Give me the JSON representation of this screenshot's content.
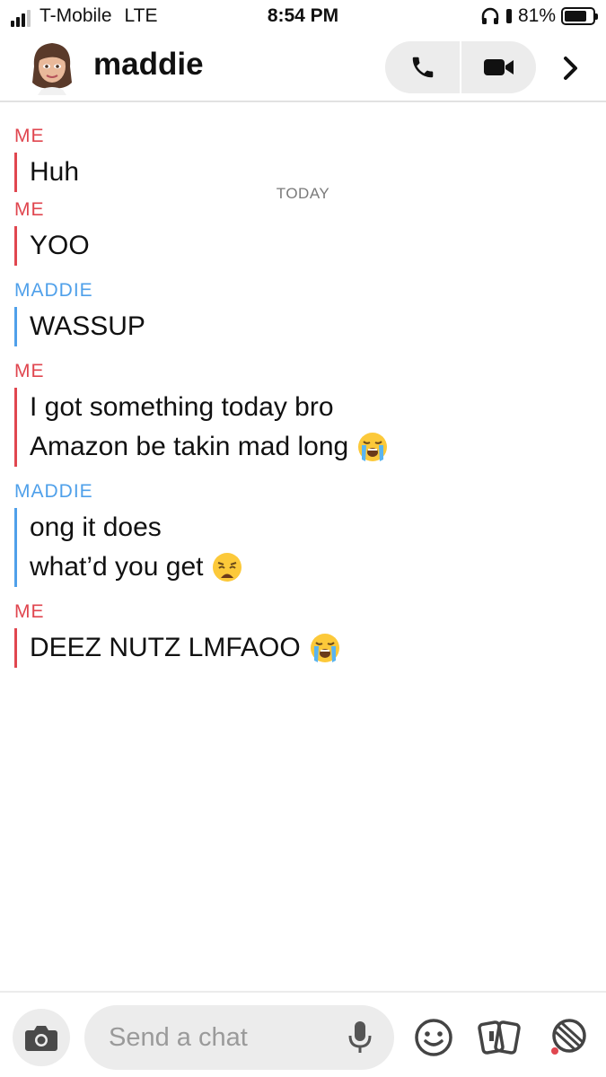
{
  "status_bar": {
    "carrier": "T-Mobile",
    "network": "LTE",
    "time": "8:54 PM",
    "battery_percent": "81%",
    "battery_level": 0.81
  },
  "header": {
    "contact_name": "maddie"
  },
  "divider_label": "TODAY",
  "messages": [
    {
      "sender": "ME",
      "lines": [
        "Huh"
      ]
    },
    {
      "sender": "ME",
      "lines": [
        "YOO"
      ]
    },
    {
      "sender": "MADDIE",
      "lines": [
        "WASSUP"
      ]
    },
    {
      "sender": "ME",
      "lines": [
        "I got something today bro",
        "Amazon be takin mad long"
      ]
    },
    {
      "sender": "MADDIE",
      "lines": [
        "ong it does",
        "what’d you get"
      ]
    },
    {
      "sender": "ME",
      "lines": [
        "DEEZ NUTZ LMFAOO"
      ]
    }
  ],
  "emojis": {
    "crying": "loudly-crying-face",
    "weary": "weary-face"
  },
  "composer": {
    "placeholder": "Send a chat"
  },
  "colors": {
    "me": "#e0464f",
    "them": "#4fa0ea"
  }
}
